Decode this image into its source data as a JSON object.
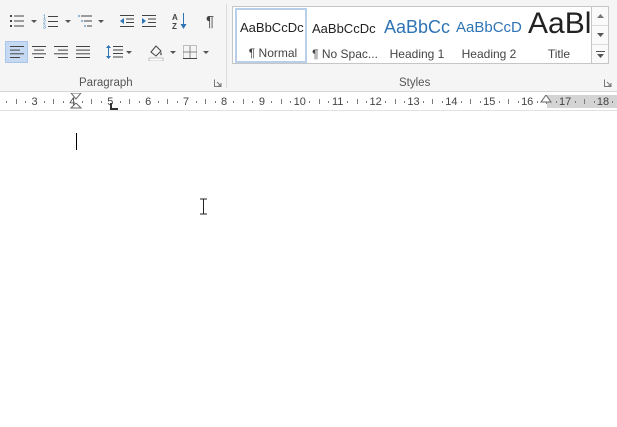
{
  "paragraph_group": {
    "label": "Paragraph",
    "icons": {
      "bullets": "bullets-icon",
      "numbering": "numbering-icon",
      "multilevel": "multilevel-list-icon",
      "decrease_indent": "decrease-indent-icon",
      "increase_indent": "increase-indent-icon",
      "sort": "sort-icon",
      "show_marks": "pilcrow-icon",
      "align_left": "align-left-icon",
      "center": "align-center-icon",
      "align_right": "align-right-icon",
      "justify": "justify-icon",
      "line_spacing": "line-spacing-icon",
      "shading": "shading-icon",
      "borders": "borders-icon"
    },
    "sort_glyph": "AZ",
    "pilcrow_glyph": "¶"
  },
  "styles_group": {
    "label": "Styles",
    "items": [
      {
        "sample": "AaBbCcDc",
        "name": "¶ Normal",
        "selected": true
      },
      {
        "sample": "AaBbCcDc",
        "name": "¶ No Spac..."
      },
      {
        "sample": "AaBbCc",
        "name": "Heading 1"
      },
      {
        "sample": "AaBbCcD",
        "name": "Heading 2"
      },
      {
        "sample": "AaBl",
        "name": "Title"
      }
    ]
  },
  "ruler": {
    "numbers": [
      "3",
      "4",
      "5",
      "6",
      "7",
      "8",
      "9",
      "10",
      "11",
      "12",
      "13",
      "14",
      "15",
      "16",
      "17",
      "18"
    ]
  },
  "colors": {
    "heading_blue": "#2e74b5",
    "selected_fill": "#c5daf2",
    "ribbon_bg": "#f5f5f5"
  }
}
